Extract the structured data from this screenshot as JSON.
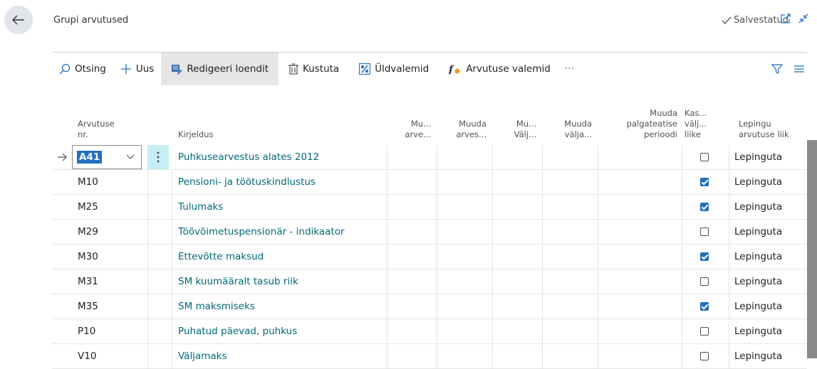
{
  "header": {
    "title": "Grupi arvutused",
    "status": "Salvestatud"
  },
  "toolbar": {
    "search": "Otsing",
    "new": "Uus",
    "edit_list": "Redigeeri loendit",
    "delete": "Kustuta",
    "general_formulas": "Üldvalemid",
    "calc_formulas": "Arvutuse valemid",
    "more": "···"
  },
  "columns": {
    "nr": [
      "Arvutuse",
      "nr."
    ],
    "desc": "Kirjeldus",
    "c1": [
      "Mu...",
      "arve..."
    ],
    "c2": [
      "Muuda",
      "arves..."
    ],
    "c3": [
      "Mu...",
      "Välj..."
    ],
    "c4": [
      "Muuda",
      "välja..."
    ],
    "c5": [
      "Muuda",
      "palgateatise",
      "perioodi"
    ],
    "c6": [
      "Kas...",
      "välj...",
      "liike"
    ],
    "c7": [
      "Lepingu",
      "arvutuse liik"
    ]
  },
  "rows": [
    {
      "nr": "A41",
      "desc": "Puhkusearvestus alates 2012",
      "checked": false,
      "type": "Lepinguta"
    },
    {
      "nr": "M10",
      "desc": "Pensioni- ja töötuskindlustus",
      "checked": true,
      "type": "Lepinguta"
    },
    {
      "nr": "M25",
      "desc": "Tulumaks",
      "checked": true,
      "type": "Lepinguta"
    },
    {
      "nr": "M29",
      "desc": "Töövõimetuspensionär - indikaator",
      "checked": false,
      "type": "Lepinguta"
    },
    {
      "nr": "M30",
      "desc": "Ettevõtte maksud",
      "checked": true,
      "type": "Lepinguta"
    },
    {
      "nr": "M31",
      "desc": "SM kuumääralt tasub riik",
      "checked": false,
      "type": "Lepinguta"
    },
    {
      "nr": "M35",
      "desc": "SM maksmiseks",
      "checked": true,
      "type": "Lepinguta"
    },
    {
      "nr": "P10",
      "desc": "Puhatud päevad, puhkus",
      "checked": false,
      "type": "Lepinguta"
    },
    {
      "nr": "V10",
      "desc": "Väljamaks",
      "checked": false,
      "type": "Lepinguta"
    }
  ],
  "icons": {
    "back": "arrow-left-icon",
    "check": "checkmark-icon",
    "open_new": "open-in-new-window-icon",
    "collapse": "collapse-icon",
    "search": "search-icon",
    "new": "plus-icon",
    "edit_list": "edit-list-icon",
    "delete": "trash-icon",
    "general_formulas": "percent-icon",
    "calc_formulas": "function-icon",
    "filter": "filter-icon",
    "list_view": "list-view-icon",
    "row_arrow": "arrow-right-icon",
    "dropdown": "chevron-down-icon",
    "row_menu": "vertical-dots-icon"
  },
  "colors": {
    "accent": "#00687a",
    "checkbox": "#1f6fbf",
    "selection": "#1f6fbf",
    "selected_cell": "#c6eef4"
  }
}
